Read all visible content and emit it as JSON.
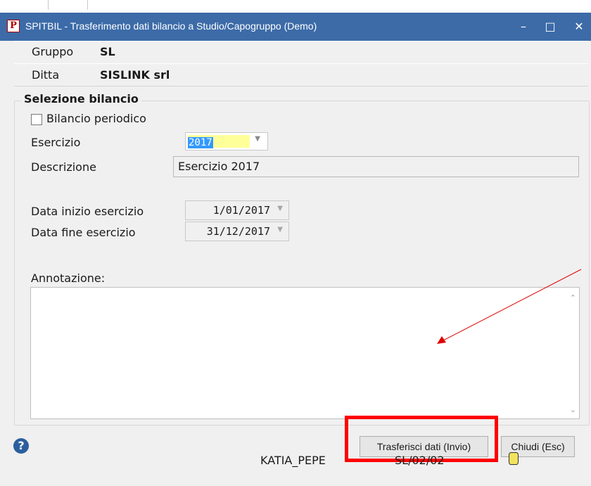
{
  "window": {
    "title": "SPITBIL - Trasferimento dati bilancio a Studio/Capogruppo  (Demo)",
    "app_icon_letter": "P",
    "minimize_glyph": "–",
    "maximize_glyph": "□",
    "close_glyph": "✕"
  },
  "header": {
    "gruppo_label": "Gruppo",
    "gruppo_value": "SL",
    "ditta_label": "Ditta",
    "ditta_value": "SISLINK srl"
  },
  "selezione": {
    "legend": "Selezione bilancio",
    "periodico_label": "Bilancio periodico",
    "periodico_checked": false,
    "esercizio_label": "Esercizio",
    "esercizio_value": "2017",
    "descrizione_label": "Descrizione",
    "descrizione_value": "Esercizio 2017",
    "data_inizio_label": "Data inizio esercizio",
    "data_inizio_value": "1/01/2017",
    "data_fine_label": "Data fine esercizio",
    "data_fine_value": "31/12/2017",
    "annotazione_label": "Annotazione:",
    "annotazione_value": ""
  },
  "buttons": {
    "help_glyph": "?",
    "trasferisci_label": "Trasferisci dati (Invio)",
    "chiudi_label": "Chiudi (Esc)"
  },
  "statusbar": {
    "user": "KATIA_PEPE",
    "code": "SL/02/02"
  },
  "colors": {
    "titlebar": "#3c6ba8",
    "highlight_box": "#ff0000",
    "annotation_arrow": "#e00000",
    "selection": "#3399ff",
    "input_yellow": "#ffff99"
  }
}
